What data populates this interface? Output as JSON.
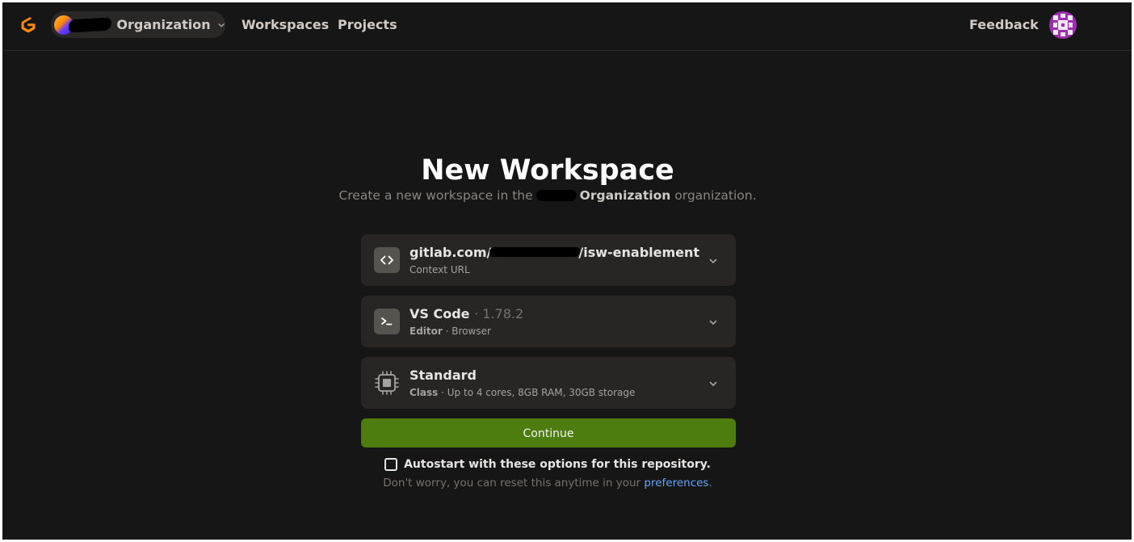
{
  "header": {
    "org_label": "Organization",
    "nav": {
      "workspaces": "Workspaces",
      "projects": "Projects",
      "feedback": "Feedback"
    }
  },
  "main": {
    "title": "New Workspace",
    "subtitle_prefix": "Create a new workspace in the",
    "subtitle_org": "Organization",
    "subtitle_suffix": "organization."
  },
  "cards": {
    "context_url": {
      "title_prefix": "gitlab.com/",
      "title_suffix": "/isw-enablement",
      "label": "Context URL",
      "icon": "code-brackets-icon"
    },
    "editor": {
      "title": "VS Code",
      "version": "· 1.78.2",
      "label": "Editor",
      "detail": "· Browser",
      "icon": "terminal-icon"
    },
    "workspace_class": {
      "title": "Standard",
      "label": "Class",
      "detail": "· Up to 4 cores, 8GB RAM, 30GB storage",
      "icon": "cpu-chip-icon"
    }
  },
  "actions": {
    "continue_label": "Continue",
    "autostart_label": "Autostart with these options for this repository.",
    "autostart_checked": false,
    "hint_prefix": "Don't worry, you can reset this anytime in your",
    "hint_link": "preferences",
    "hint_suffix": "."
  },
  "colors": {
    "background": "#161616",
    "card": "#292524",
    "continue_button": "#4d7c0f",
    "link": "#60a5fa",
    "logo": "#ff8a00"
  }
}
